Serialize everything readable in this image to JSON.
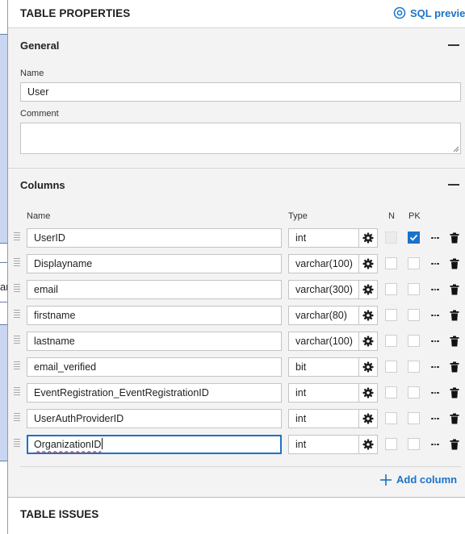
{
  "left_strip": {
    "glyph": "ar"
  },
  "header": {
    "title": "TABLE PROPERTIES",
    "sql_preview_label": "SQL preview",
    "sql_preview_icon": "eye-icon"
  },
  "general": {
    "title": "General",
    "name_label": "Name",
    "name_value": "User",
    "comment_label": "Comment",
    "comment_value": ""
  },
  "columns": {
    "title": "Columns",
    "headers": {
      "name": "Name",
      "type": "Type",
      "n": "N",
      "pk": "PK"
    },
    "rows": [
      {
        "name": "UserID",
        "type": "int",
        "n_checked": false,
        "n_disabled": true,
        "pk_checked": true
      },
      {
        "name": "Displayname",
        "type": "varchar(100)",
        "n_checked": false,
        "n_disabled": false,
        "pk_checked": false
      },
      {
        "name": "email",
        "type": "varchar(300)",
        "n_checked": false,
        "n_disabled": false,
        "pk_checked": false
      },
      {
        "name": "firstname",
        "type": "varchar(80)",
        "n_checked": false,
        "n_disabled": false,
        "pk_checked": false
      },
      {
        "name": "lastname",
        "type": "varchar(100)",
        "n_checked": false,
        "n_disabled": false,
        "pk_checked": false
      },
      {
        "name": "email_verified",
        "type": "bit",
        "n_checked": false,
        "n_disabled": false,
        "pk_checked": false
      },
      {
        "name": "EventRegistration_EventRegistrationID",
        "type": "int",
        "n_checked": false,
        "n_disabled": false,
        "pk_checked": false
      },
      {
        "name": "UserAuthProviderID",
        "type": "int",
        "n_checked": false,
        "n_disabled": false,
        "pk_checked": false
      },
      {
        "name": "OrganizationID",
        "type": "int",
        "n_checked": false,
        "n_disabled": false,
        "pk_checked": false,
        "focused": true
      }
    ],
    "add_column_label": "Add column"
  },
  "issues": {
    "title": "TABLE ISSUES"
  },
  "colors": {
    "accent": "#1a73c9",
    "panel_bg": "#f3f3f3",
    "strip_block": "#c9d6f2"
  }
}
